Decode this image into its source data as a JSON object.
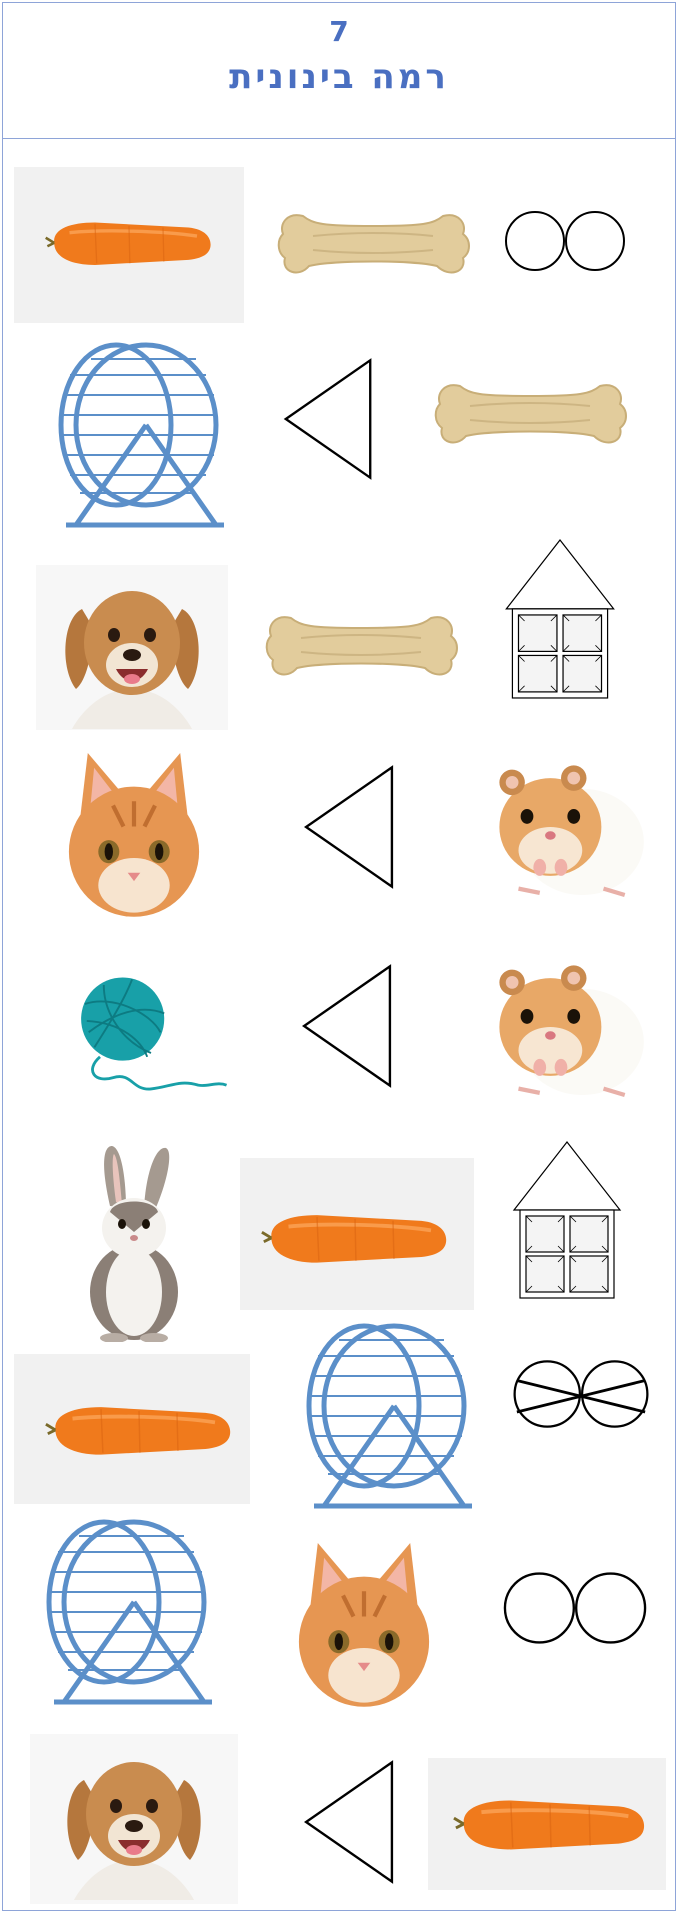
{
  "header": {
    "number": "7",
    "title": "רמה בינונית"
  },
  "colors": {
    "frame": "#8ea4d8",
    "title": "#4a6fc1",
    "carrot": "#f07a1c",
    "bone": "#e2cc9c",
    "wheel": "#5b8fc9",
    "yarn": "#18a0a8",
    "hamster": "#e8a867",
    "cat": "#e69652",
    "dog": "#c98c4f"
  },
  "rows": [
    {
      "items": [
        "carrot",
        "bone",
        "two-circles"
      ]
    },
    {
      "items": [
        "hamster-wheel",
        "triangle",
        "bone"
      ]
    },
    {
      "items": [
        "dog",
        "bone",
        "house"
      ]
    },
    {
      "items": [
        "cat",
        "triangle",
        "hamster"
      ]
    },
    {
      "items": [
        "yarn-ball",
        "triangle",
        "hamster"
      ]
    },
    {
      "items": [
        "rabbit",
        "carrot",
        "house"
      ]
    },
    {
      "items": [
        "carrot",
        "hamster-wheel",
        "crossed-circles"
      ]
    },
    {
      "items": [
        "hamster-wheel",
        "cat",
        "two-circles"
      ]
    },
    {
      "items": [
        "dog",
        "triangle",
        "carrot"
      ]
    }
  ]
}
